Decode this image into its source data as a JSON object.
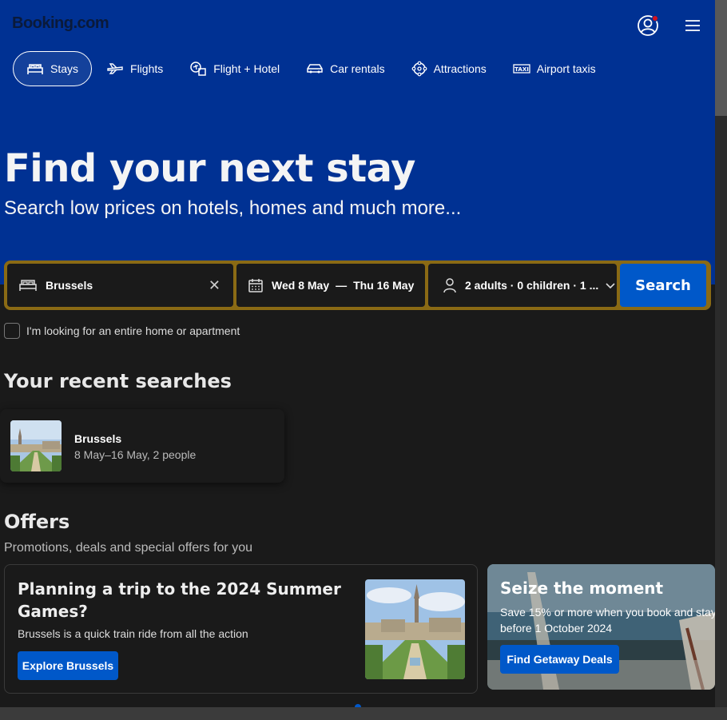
{
  "header": {
    "logo": "Booking.com",
    "nav": [
      {
        "label": "Stays",
        "icon": "bed-icon",
        "active": true
      },
      {
        "label": "Flights",
        "icon": "plane-icon"
      },
      {
        "label": "Flight + Hotel",
        "icon": "flight-hotel-icon"
      },
      {
        "label": "Car rentals",
        "icon": "car-icon"
      },
      {
        "label": "Attractions",
        "icon": "attractions-icon"
      },
      {
        "label": "Airport taxis",
        "icon": "taxi-icon"
      }
    ]
  },
  "hero": {
    "title": "Find your next stay",
    "subtitle": "Search low prices on hotels, homes and much more..."
  },
  "search": {
    "destination": "Brussels",
    "checkin": "Wed 8 May",
    "date_separator": "—",
    "checkout": "Thu 16 May",
    "guests": "2 adults · 0 children · 1 ...",
    "button": "Search",
    "entire_home_label": "I'm looking for an entire home or apartment"
  },
  "recent": {
    "title": "Your recent searches",
    "items": [
      {
        "city": "Brussels",
        "meta": "8 May–16 May, 2 people"
      }
    ]
  },
  "offers": {
    "title": "Offers",
    "subtitle": "Promotions, deals and special offers for you",
    "cards": [
      {
        "title": "Planning a trip to the 2024 Summer Games?",
        "text": "Brussels is a quick train ride from all the action",
        "button": "Explore Brussels"
      },
      {
        "title": "Seize the moment",
        "text": "Save 15% or more when you book and stay before 1 October 2024",
        "button": "Find Getaway Deals"
      }
    ]
  },
  "colors": {
    "brand_blue": "#003193",
    "button_blue": "#0058c9",
    "search_border": "#8a6a14",
    "background": "#1a1a1a"
  }
}
